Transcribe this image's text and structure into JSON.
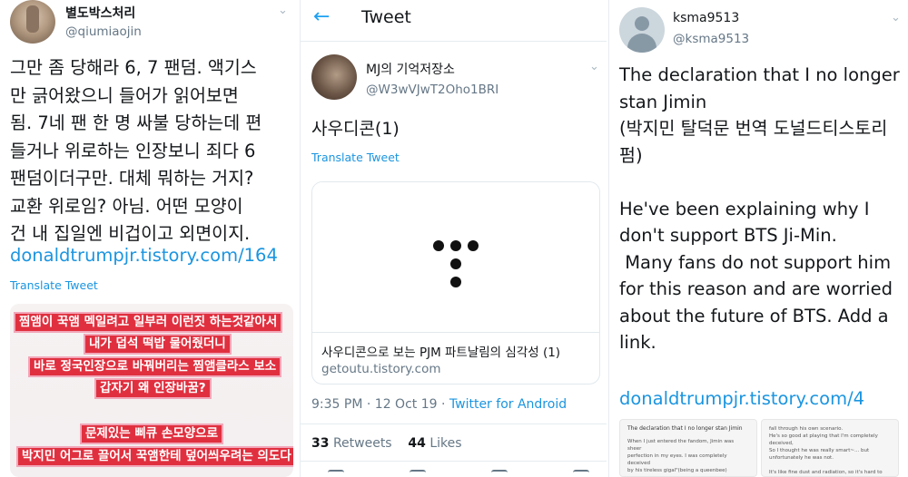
{
  "panel1": {
    "user_name": "별도박스처리",
    "handle": "@qiumiaojin",
    "tweet_lines": [
      "그만 좀 당해라 6, 7 팬덤. 액기스",
      "만 긁어왔으니 들어가 읽어보면",
      "됨. 7네 팬 한 명 싸불 당하는데 편",
      "들거나 위로하는 인장보니 죄다 6",
      "팬덤이더구만. 대체 뭐하는 거지?",
      "교환 위로임? 아님. 어떤 모양이",
      "건 내 집일엔 비겁이고 외면이지."
    ],
    "link": "donaldtrumpjr.tistory.com/164",
    "translate": "Translate Tweet",
    "image_lines": [
      "찜앰이 꾹앰 멕일려고 일부러 이런짓 하는것같아서",
      "내가 덥석 떡밥 물어줬더니",
      "바로 정국인장으로 바꿔버리는 찜앰클라스 보소",
      "갑자기 왜 인장바꿈?",
      "문제있는 삐큐 손모양으로",
      "박지민 어그로 끌어서 꾹앰한테 덮어씌우려는 의도다"
    ]
  },
  "panel2": {
    "header_title": "Tweet",
    "user_name": "MJ의 기억저장소",
    "handle": "@W3wVJwT2Oho1BRI",
    "tweet_text": "사우디콘(1)",
    "translate": "Translate Tweet",
    "card": {
      "title": "사우디콘으로 보는 PJM 파트날림의 심각성 (1)",
      "url": "getoutu.tistory.com"
    },
    "time": "9:35 PM",
    "date": "12 Oct 19",
    "source": "Twitter for Android",
    "retweets_count": "33",
    "retweets_label": "Retweets",
    "likes_count": "44",
    "likes_label": "Likes"
  },
  "panel3": {
    "user_name": "ksma9513",
    "handle": "@ksma9513",
    "tweet_lines": [
      "The declaration that I no longer",
      "stan Jimin",
      "(박지민 탈덕문 번역 도널드티스토리",
      "펌)",
      "",
      "He've been explaining why I",
      "don't support BTS Ji-Min.",
      " Many fans do not support him",
      "for this reason and are worried",
      "about the future of BTS. Add a",
      "link."
    ],
    "link": "donaldtrumpjr.tistory.com/4",
    "thumb_left": {
      "title": "The declaration that I no longer stan Jimin",
      "lines": [
        "When I just entered the fandom, Jimin was sheer",
        "perfection in my eyes. I was completely deceived",
        "by his tireless gigal\"(being a queenbee)"
      ]
    },
    "thumb_right": {
      "lines": [
        "fall through his own scenario.",
        "He's so good at playing that I'm completely",
        "deceived,",
        "So I thought he was really smart~... but",
        "unfortunately he was not.",
        "",
        "It's like fine dust and radiation, so it's hard to"
      ]
    }
  }
}
